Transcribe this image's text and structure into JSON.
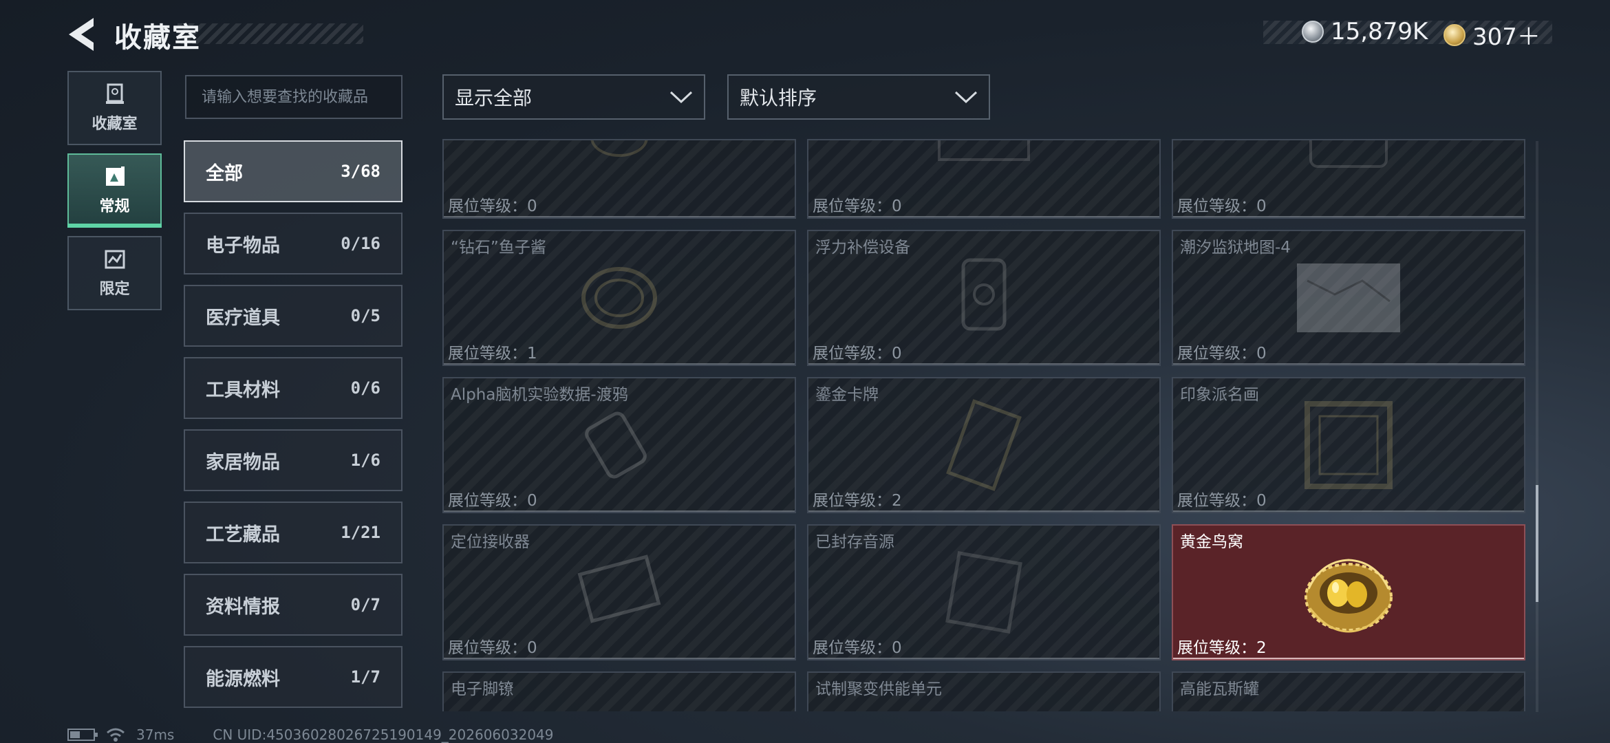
{
  "header": {
    "title": "收藏室",
    "currencies": [
      {
        "icon": "silver-coin-icon",
        "value": "15,879K"
      },
      {
        "icon": "gold-coin-icon",
        "value": "307＋"
      }
    ]
  },
  "side_tabs": [
    {
      "label": "收藏室",
      "icon": "trophy-icon",
      "active": false
    },
    {
      "label": "常规",
      "icon": "gallery-icon",
      "active": true
    },
    {
      "label": "限定",
      "icon": "limited-icon",
      "active": false
    }
  ],
  "search": {
    "placeholder": "请输入想要查找的收藏品",
    "value": ""
  },
  "categories": [
    {
      "name": "全部",
      "count": "3/68"
    },
    {
      "name": "电子物品",
      "count": "0/16"
    },
    {
      "name": "医疗道具",
      "count": "0/5"
    },
    {
      "name": "工具材料",
      "count": "0/6"
    },
    {
      "name": "家居物品",
      "count": "1/6"
    },
    {
      "name": "工艺藏品",
      "count": "1/21"
    },
    {
      "name": "资料情报",
      "count": "0/7"
    },
    {
      "name": "能源燃料",
      "count": "1/7"
    }
  ],
  "filters": {
    "display": "显示全部",
    "sort": "默认排序"
  },
  "items": [
    {
      "name": "",
      "level": "展位等级：0",
      "owned": false
    },
    {
      "name": "",
      "level": "展位等级：0",
      "owned": false
    },
    {
      "name": "",
      "level": "展位等级：0",
      "owned": false
    },
    {
      "name": "“钻石”鱼子酱",
      "level": "展位等级：1",
      "owned": false
    },
    {
      "name": "浮力补偿设备",
      "level": "展位等级：0",
      "owned": false
    },
    {
      "name": "潮汐监狱地图-4",
      "level": "展位等级：0",
      "owned": false
    },
    {
      "name": "Alpha脑机实验数据-渡鸦",
      "level": "展位等级：0",
      "owned": false
    },
    {
      "name": "鎏金卡牌",
      "level": "展位等级：2",
      "owned": false
    },
    {
      "name": "印象派名画",
      "level": "展位等级：0",
      "owned": false
    },
    {
      "name": "定位接收器",
      "level": "展位等级：0",
      "owned": false
    },
    {
      "name": "已封存音源",
      "level": "展位等级：0",
      "owned": false
    },
    {
      "name": "黄金鸟窝",
      "level": "展位等级：2",
      "owned": true
    },
    {
      "name": "电子脚镣",
      "level": "",
      "owned": false
    },
    {
      "name": "试制聚变供能单元",
      "level": "",
      "owned": false
    },
    {
      "name": "高能瓦斯罐",
      "level": "",
      "owned": false
    }
  ],
  "status_bar": {
    "ping": "37ms",
    "uid": "CN UID:4503602802672519​0149_202606032049"
  }
}
